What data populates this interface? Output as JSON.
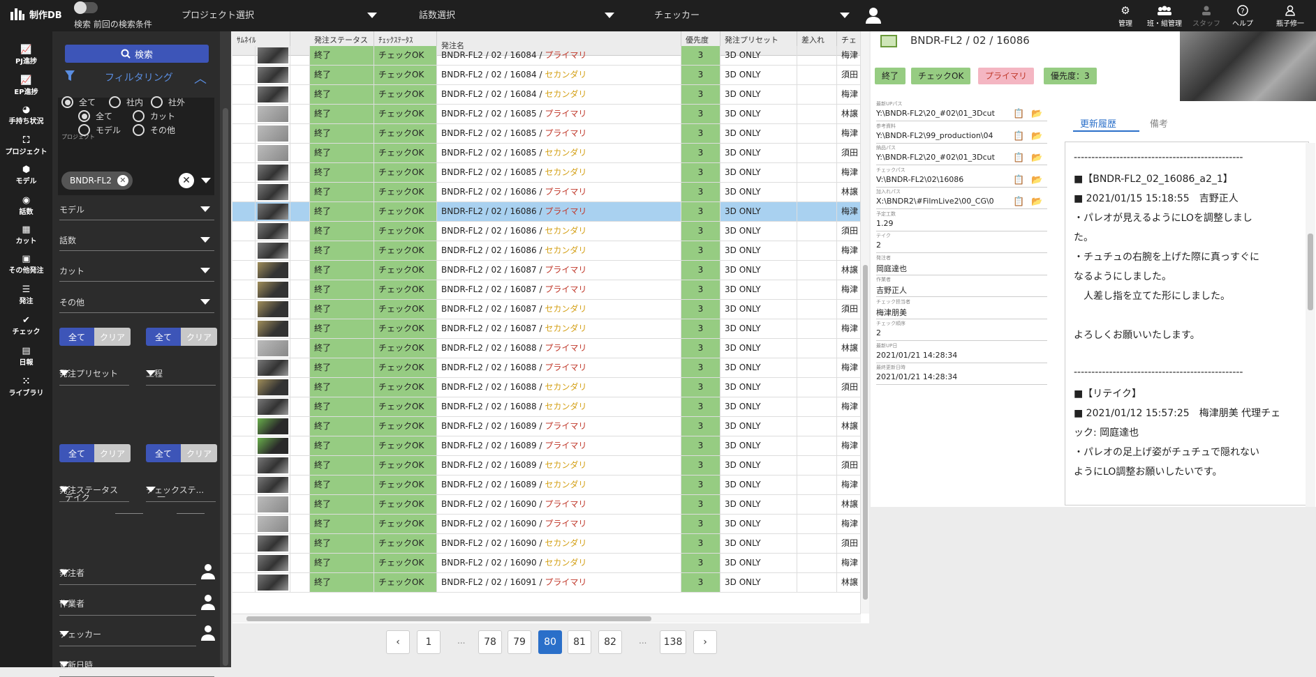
{
  "app": {
    "title": "制作DB"
  },
  "topbar": {
    "toggle_label": "検索 前回の検索条件",
    "selects": [
      "プロジェクト選択",
      "話数選択",
      "チェッカー"
    ],
    "nav": [
      {
        "label": "管理",
        "icon": "gear-icon"
      },
      {
        "label": "班・組管理",
        "icon": "group-icon"
      },
      {
        "label": "スタッフ",
        "icon": "staff-icon"
      },
      {
        "label": "ヘルプ",
        "icon": "help-icon"
      },
      {
        "label": "瓶子修一",
        "icon": "user-icon"
      }
    ]
  },
  "leftnav": [
    {
      "label": "PJ進捗",
      "icon": "chart-icon"
    },
    {
      "label": "EP進捗",
      "icon": "chart-icon"
    },
    {
      "label": "手持ち状況",
      "icon": "pie-icon"
    },
    {
      "label": "プロジェクト",
      "icon": "project-icon"
    },
    {
      "label": "モデル",
      "icon": "cube-icon"
    },
    {
      "label": "話数",
      "icon": "episode-icon"
    },
    {
      "label": "カット",
      "icon": "film-icon"
    },
    {
      "label": "その他発注",
      "icon": "image-icon"
    },
    {
      "label": "発注",
      "icon": "list-icon"
    },
    {
      "label": "チェック",
      "icon": "check-icon"
    },
    {
      "label": "日報",
      "icon": "calendar-icon"
    },
    {
      "label": "ライブラリ",
      "icon": "grid-icon"
    }
  ],
  "filter": {
    "search_label": "検索",
    "header": "フィルタリング",
    "radio_row1": [
      "全て",
      "社内",
      "社外"
    ],
    "radio_row2": [
      "全て",
      "カット"
    ],
    "radio_row3": [
      "モデル",
      "その他"
    ],
    "project_label": "プロジェクト",
    "project_chip": "BNDR-FL2",
    "dropdowns": [
      "モデル",
      "話数",
      "カット",
      "その他"
    ],
    "all_label": "全て",
    "clear_label": "クリア",
    "preset_label": "発注プリセット",
    "process_label": "工程",
    "order_status_label": "発注ステータス",
    "check_status_label": "チェックステ...",
    "take_label": "テイク",
    "take_sep": "—",
    "orderer_label": "発注者",
    "worker_label": "作業者",
    "checker_label": "チェッカー",
    "updated_label": "更新日時"
  },
  "grid": {
    "headers": {
      "thumb": "ｻﾑﾈｲﾙ",
      "order_status": "発注ステータス",
      "check_status": "ﾁｪｯｸｽﾃｰﾀｽ",
      "name": "発注名",
      "priority": "優先度",
      "preset": "発注プリセット",
      "dashi": "差入れ",
      "checker": "チェ"
    },
    "rows": [
      {
        "os": "終了",
        "cs": "チェックOK",
        "name": "BNDR-FL2 / 02 / 16084 / ",
        "kind": "プライマリ",
        "pr": "3",
        "ps": "3D ONLY",
        "ch": "梅津",
        "th": "d"
      },
      {
        "os": "終了",
        "cs": "チェックOK",
        "name": "BNDR-FL2 / 02 / 16084 / ",
        "kind": "セカンダリ",
        "pr": "3",
        "ps": "3D ONLY",
        "ch": "須田",
        "th": "d"
      },
      {
        "os": "終了",
        "cs": "チェックOK",
        "name": "BNDR-FL2 / 02 / 16084 / ",
        "kind": "セカンダリ",
        "pr": "3",
        "ps": "3D ONLY",
        "ch": "梅津",
        "th": "d"
      },
      {
        "os": "終了",
        "cs": "チェックOK",
        "name": "BNDR-FL2 / 02 / 16085 / ",
        "kind": "プライマリ",
        "pr": "3",
        "ps": "3D ONLY",
        "ch": "林譲",
        "th": "l"
      },
      {
        "os": "終了",
        "cs": "チェックOK",
        "name": "BNDR-FL2 / 02 / 16085 / ",
        "kind": "プライマリ",
        "pr": "3",
        "ps": "3D ONLY",
        "ch": "梅津",
        "th": "l"
      },
      {
        "os": "終了",
        "cs": "チェックOK",
        "name": "BNDR-FL2 / 02 / 16085 / ",
        "kind": "セカンダリ",
        "pr": "3",
        "ps": "3D ONLY",
        "ch": "須田",
        "th": "l"
      },
      {
        "os": "終了",
        "cs": "チェックOK",
        "name": "BNDR-FL2 / 02 / 16085 / ",
        "kind": "セカンダリ",
        "pr": "3",
        "ps": "3D ONLY",
        "ch": "梅津",
        "th": "d"
      },
      {
        "os": "終了",
        "cs": "チェックOK",
        "name": "BNDR-FL2 / 02 / 16086 / ",
        "kind": "プライマリ",
        "pr": "3",
        "ps": "3D ONLY",
        "ch": "林譲",
        "th": "d"
      },
      {
        "os": "終了",
        "cs": "チェックOK",
        "name": "BNDR-FL2 / 02 / 16086 / ",
        "kind": "プライマリ",
        "pr": "3",
        "ps": "3D ONLY",
        "ch": "梅津",
        "th": "d",
        "sel": true
      },
      {
        "os": "終了",
        "cs": "チェックOK",
        "name": "BNDR-FL2 / 02 / 16086 / ",
        "kind": "セカンダリ",
        "pr": "3",
        "ps": "3D ONLY",
        "ch": "須田",
        "th": "d"
      },
      {
        "os": "終了",
        "cs": "チェックOK",
        "name": "BNDR-FL2 / 02 / 16086 / ",
        "kind": "セカンダリ",
        "pr": "3",
        "ps": "3D ONLY",
        "ch": "梅津",
        "th": "d"
      },
      {
        "os": "終了",
        "cs": "チェックOK",
        "name": "BNDR-FL2 / 02 / 16087 / ",
        "kind": "プライマリ",
        "pr": "3",
        "ps": "3D ONLY",
        "ch": "林譲",
        "th": "y"
      },
      {
        "os": "終了",
        "cs": "チェックOK",
        "name": "BNDR-FL2 / 02 / 16087 / ",
        "kind": "プライマリ",
        "pr": "3",
        "ps": "3D ONLY",
        "ch": "梅津",
        "th": "y"
      },
      {
        "os": "終了",
        "cs": "チェックOK",
        "name": "BNDR-FL2 / 02 / 16087 / ",
        "kind": "セカンダリ",
        "pr": "3",
        "ps": "3D ONLY",
        "ch": "須田",
        "th": "y"
      },
      {
        "os": "終了",
        "cs": "チェックOK",
        "name": "BNDR-FL2 / 02 / 16087 / ",
        "kind": "セカンダリ",
        "pr": "3",
        "ps": "3D ONLY",
        "ch": "梅津",
        "th": "y"
      },
      {
        "os": "終了",
        "cs": "チェックOK",
        "name": "BNDR-FL2 / 02 / 16088 / ",
        "kind": "プライマリ",
        "pr": "3",
        "ps": "3D ONLY",
        "ch": "林譲",
        "th": "l"
      },
      {
        "os": "終了",
        "cs": "チェックOK",
        "name": "BNDR-FL2 / 02 / 16088 / ",
        "kind": "プライマリ",
        "pr": "3",
        "ps": "3D ONLY",
        "ch": "梅津",
        "th": "d"
      },
      {
        "os": "終了",
        "cs": "チェックOK",
        "name": "BNDR-FL2 / 02 / 16088 / ",
        "kind": "セカンダリ",
        "pr": "3",
        "ps": "3D ONLY",
        "ch": "須田",
        "th": "y"
      },
      {
        "os": "終了",
        "cs": "チェックOK",
        "name": "BNDR-FL2 / 02 / 16088 / ",
        "kind": "セカンダリ",
        "pr": "3",
        "ps": "3D ONLY",
        "ch": "梅津",
        "th": "d"
      },
      {
        "os": "終了",
        "cs": "チェックOK",
        "name": "BNDR-FL2 / 02 / 16089 / ",
        "kind": "プライマリ",
        "pr": "3",
        "ps": "3D ONLY",
        "ch": "林譲",
        "th": "g"
      },
      {
        "os": "終了",
        "cs": "チェックOK",
        "name": "BNDR-FL2 / 02 / 16089 / ",
        "kind": "プライマリ",
        "pr": "3",
        "ps": "3D ONLY",
        "ch": "梅津",
        "th": "g"
      },
      {
        "os": "終了",
        "cs": "チェックOK",
        "name": "BNDR-FL2 / 02 / 16089 / ",
        "kind": "セカンダリ",
        "pr": "3",
        "ps": "3D ONLY",
        "ch": "須田",
        "th": "d"
      },
      {
        "os": "終了",
        "cs": "チェックOK",
        "name": "BNDR-FL2 / 02 / 16089 / ",
        "kind": "セカンダリ",
        "pr": "3",
        "ps": "3D ONLY",
        "ch": "梅津",
        "th": "d"
      },
      {
        "os": "終了",
        "cs": "チェックOK",
        "name": "BNDR-FL2 / 02 / 16090 / ",
        "kind": "プライマリ",
        "pr": "3",
        "ps": "3D ONLY",
        "ch": "林譲",
        "th": "l"
      },
      {
        "os": "終了",
        "cs": "チェックOK",
        "name": "BNDR-FL2 / 02 / 16090 / ",
        "kind": "プライマリ",
        "pr": "3",
        "ps": "3D ONLY",
        "ch": "梅津",
        "th": "l"
      },
      {
        "os": "終了",
        "cs": "チェックOK",
        "name": "BNDR-FL2 / 02 / 16090 / ",
        "kind": "セカンダリ",
        "pr": "3",
        "ps": "3D ONLY",
        "ch": "須田",
        "th": "d"
      },
      {
        "os": "終了",
        "cs": "チェックOK",
        "name": "BNDR-FL2 / 02 / 16090 / ",
        "kind": "セカンダリ",
        "pr": "3",
        "ps": "3D ONLY",
        "ch": "梅津",
        "th": "d"
      },
      {
        "os": "終了",
        "cs": "チェックOK",
        "name": "BNDR-FL2 / 02 / 16091 / ",
        "kind": "プライマリ",
        "pr": "3",
        "ps": "3D ONLY",
        "ch": "林譲",
        "th": "d"
      }
    ]
  },
  "pager": {
    "pages": [
      "1",
      "78",
      "79",
      "80",
      "81",
      "82",
      "138"
    ],
    "active": "80",
    "dots": "..."
  },
  "detail": {
    "title": "BNDR-FL2 / 02 / 16086",
    "tags": [
      {
        "label": "終了",
        "bg": "#96cc82",
        "fg": "#222"
      },
      {
        "label": "チェックOK",
        "bg": "#96cc82",
        "fg": "#222"
      },
      {
        "label": "プライマリ",
        "bg": "#f4b6c2",
        "fg": "#c0392b"
      },
      {
        "label": "優先度：3",
        "bg": "#96cc82",
        "fg": "#222"
      }
    ],
    "fields": [
      {
        "label": "最新UPパス",
        "value": "Y:\\BNDR-FL2\\20_#02\\01_3Dcut",
        "icons": true
      },
      {
        "label": "参考資料",
        "value": "Y:\\BNDR-FL2\\99_production\\04",
        "icons": true
      },
      {
        "label": "納品パス",
        "value": "Y:\\BNDR-FL2\\20_#02\\01_3Dcut",
        "icons": true
      },
      {
        "label": "チェックパス",
        "value": "V:\\BNDR-FL2\\02\\16086",
        "icons": true
      },
      {
        "label": "加入れパス",
        "value": "X:\\BNDR2\\#FilmLive2\\00_CG\\0",
        "icons": true
      },
      {
        "label": "予定工数",
        "value": "1.29",
        "icons": false
      },
      {
        "label": "テイク",
        "value": "2",
        "icons": false
      },
      {
        "label": "発注者",
        "value": "岡庭達也",
        "icons": false
      },
      {
        "label": "作業者",
        "value": "吉野正人",
        "icons": false
      },
      {
        "label": "チェック担当者",
        "value": "梅津朋美",
        "icons": false
      },
      {
        "label": "チェック順序",
        "value": "2",
        "icons": false
      },
      {
        "label": "最新UP日",
        "value": "2021/01/21 14:28:34",
        "icons": false
      },
      {
        "label": "最終更新日時",
        "value": "2021/01/21 14:28:34",
        "icons": false
      }
    ],
    "tabs": [
      "更新履歴",
      "備考"
    ],
    "history": [
      "------------------------------------------------",
      "■【BNDR-FL2_02_16086_a2_1】",
      "■ 2021/01/15 15:18:55　吉野正人",
      "・パレオが見えるようにLOを調整しまし",
      "た。",
      "・チュチュの右腕を上げた際に真っすぐに",
      "なるようにしました。",
      "　人差し指を立てた形にしました。",
      "",
      "よろしくお願いいたします。",
      "",
      "------------------------------------------------",
      "■【リテイク】",
      "■ 2021/01/12 15:57:25　梅津朋美 代理チェ",
      "ック: 岡庭達也",
      "・パレオの足上げ姿がチュチュで隠れない",
      "ようにLO調整お願いしたいです。"
    ]
  }
}
